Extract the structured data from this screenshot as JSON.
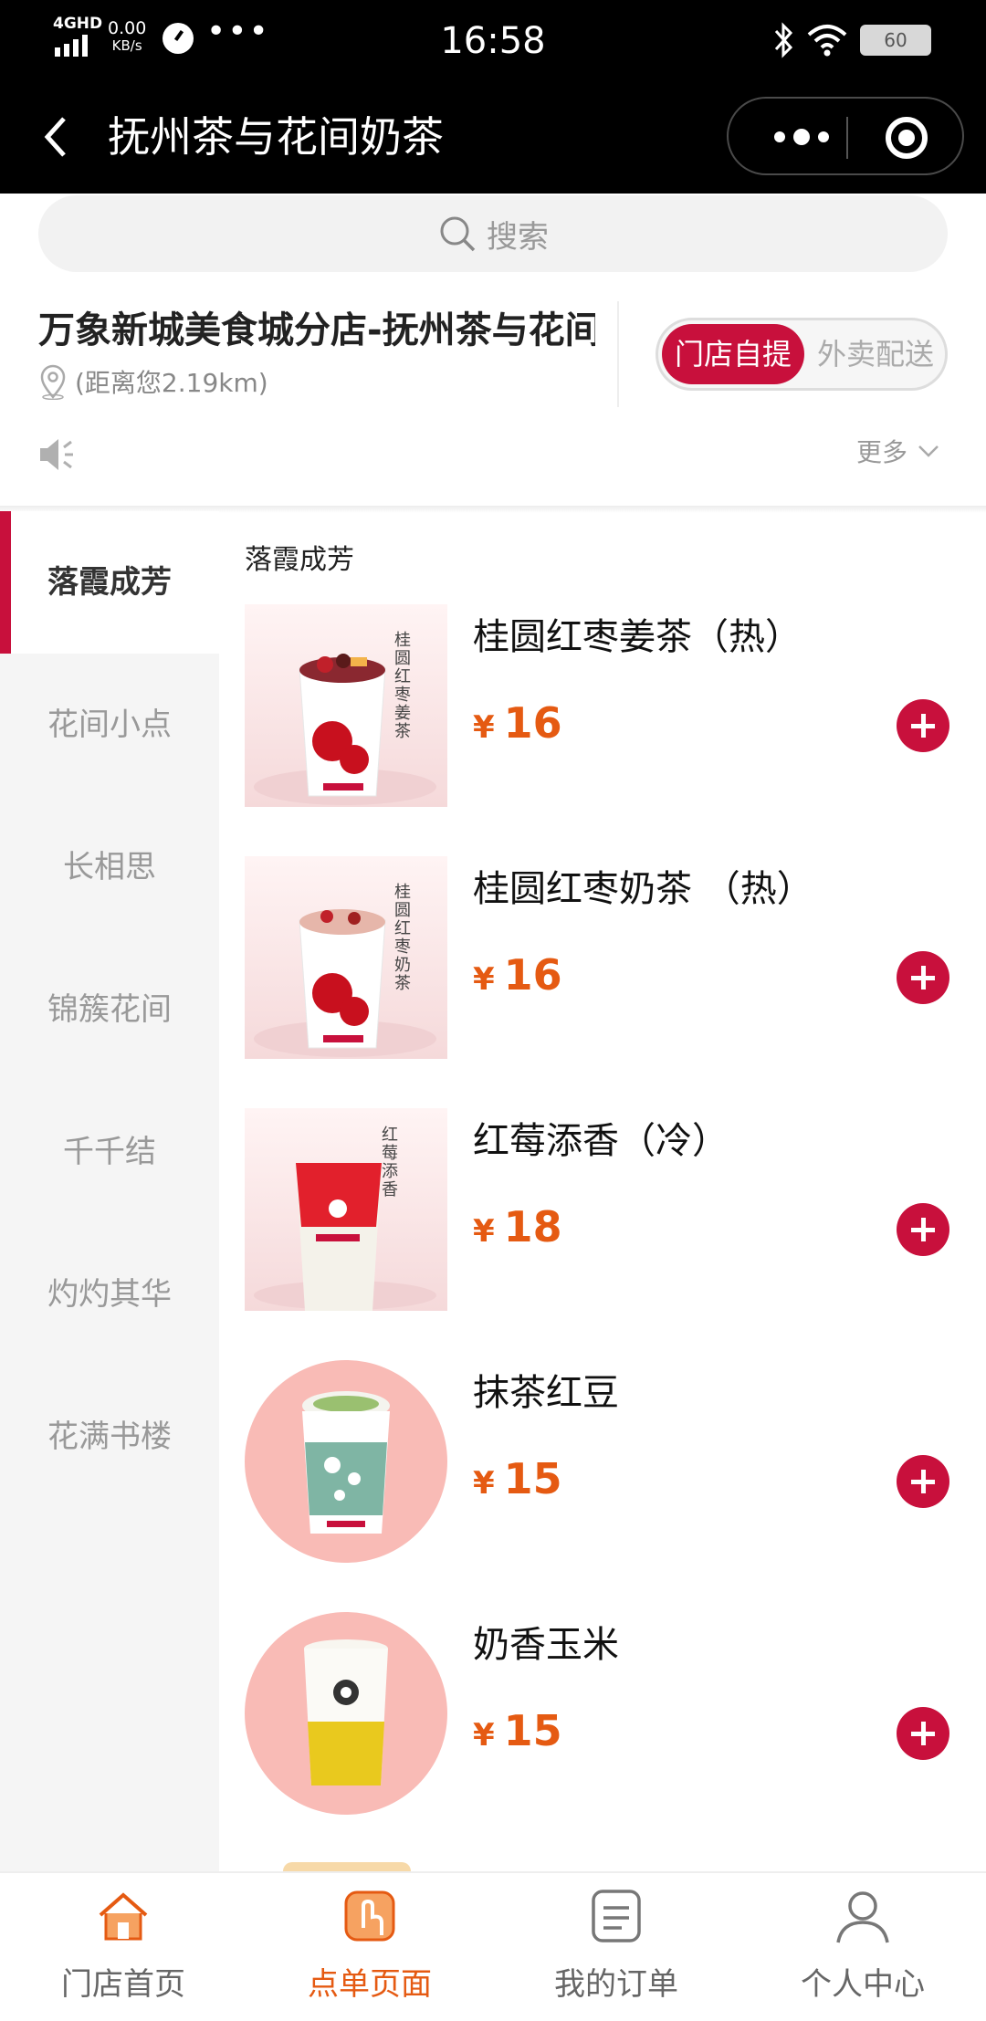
{
  "status_bar": {
    "network": "4GHD",
    "speed_value": "0.00",
    "speed_unit": "KB/s",
    "time": "16:58",
    "battery": "60"
  },
  "title_bar": {
    "title": "抚州茶与花间奶茶"
  },
  "search": {
    "placeholder": "搜索"
  },
  "store": {
    "name": "万象新城美食城分店-抚州茶与花间奶茶",
    "distance": "(距离您2.19km)",
    "mode_options": [
      "门店自提",
      "外卖配送"
    ],
    "selected_mode": "门店自提",
    "more_label": "更多"
  },
  "categories": [
    {
      "label": "落霞成芳",
      "active": true
    },
    {
      "label": "花间小点",
      "active": false
    },
    {
      "label": "长相思",
      "active": false
    },
    {
      "label": "锦簇花间",
      "active": false
    },
    {
      "label": "千千结",
      "active": false
    },
    {
      "label": "灼灼其华",
      "active": false
    },
    {
      "label": "花满书楼",
      "active": false
    }
  ],
  "section_title": "落霞成芳",
  "products": [
    {
      "name": "桂圆红枣姜茶（热）",
      "currency": "¥",
      "price": "16",
      "cup_text": "桂圆红枣姜茶"
    },
    {
      "name": "桂圆红枣奶茶 （热）",
      "currency": "¥",
      "price": "16",
      "cup_text": "桂圆红枣奶茶"
    },
    {
      "name": "红莓添香（冷）",
      "currency": "¥",
      "price": "18",
      "cup_text": "红莓添香"
    },
    {
      "name": "抹茶红豆",
      "currency": "¥",
      "price": "15",
      "cup_text": ""
    },
    {
      "name": "奶香玉米",
      "currency": "¥",
      "price": "15",
      "cup_text": ""
    }
  ],
  "tabbar": [
    {
      "label": "门店首页",
      "icon": "home-icon",
      "active": false
    },
    {
      "label": "点单页面",
      "icon": "order-icon",
      "active": true
    },
    {
      "label": "我的订单",
      "icon": "orders-list-icon",
      "active": false
    },
    {
      "label": "个人中心",
      "icon": "profile-icon",
      "active": false
    }
  ],
  "colors": {
    "brand_red": "#c8103c",
    "price_orange": "#e55a12",
    "active_tab": "#e55a12"
  }
}
